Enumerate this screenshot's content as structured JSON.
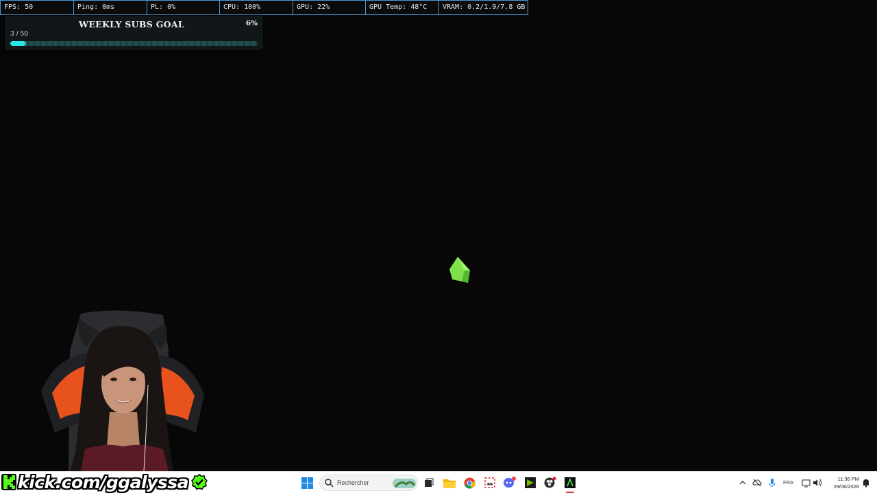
{
  "stats": {
    "fps": "FPS: 50",
    "ping": "Ping: 0ms",
    "pl": "PL: 0%",
    "cpu": "CPU: 100%",
    "gpu": "GPU: 22%",
    "gpu_temp": "GPU Temp: 48°C",
    "vram": "VRAM: 0.2/1.9/7.8 GB"
  },
  "goal": {
    "title": "WEEKLY SUBS GOAL",
    "percent_label": "6%",
    "count_label": "3 / 50",
    "progress": 0.06,
    "accent": "#29e7e7"
  },
  "overlay": {
    "kick_text": "kick.com/ggalyssa",
    "kick_color": "#53fc18"
  },
  "taskbar": {
    "search_placeholder": "Rechercher",
    "apps": [
      "windows-start-icon",
      "search-icon",
      "task-view-icon",
      "file-explorer-icon",
      "chrome-icon",
      "snipping-tool-icon",
      "discord-icon",
      "nvidia-icon",
      "obs-icon",
      "terminal-icon"
    ],
    "tray_language": "FRA",
    "time": "11:36 PM",
    "date": "29/08/2026"
  }
}
